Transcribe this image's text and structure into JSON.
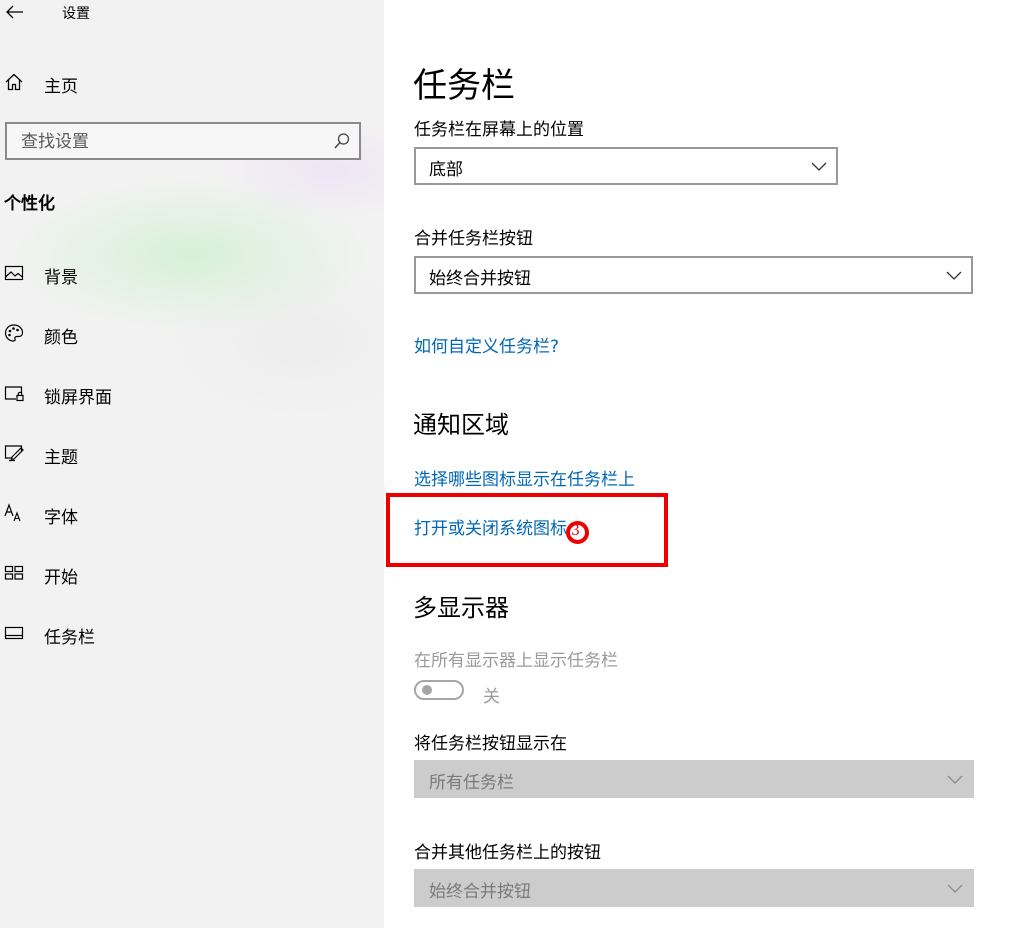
{
  "window": {
    "title": "设置"
  },
  "sidebar": {
    "home_label": "主页",
    "search_placeholder": "查找设置",
    "section_heading": "个性化",
    "items": [
      {
        "label": "背景",
        "icon": "picture-icon"
      },
      {
        "label": "颜色",
        "icon": "palette-icon"
      },
      {
        "label": "锁屏界面",
        "icon": "lock-screen-icon"
      },
      {
        "label": "主题",
        "icon": "theme-icon"
      },
      {
        "label": "字体",
        "icon": "font-icon"
      },
      {
        "label": "开始",
        "icon": "start-icon"
      },
      {
        "label": "任务栏",
        "icon": "taskbar-icon"
      }
    ]
  },
  "main": {
    "title": "任务栏",
    "position_label": "任务栏在屏幕上的位置",
    "position_value": "底部",
    "combine_label": "合并任务栏按钮",
    "combine_value": "始终合并按钮",
    "customize_link": "如何自定义任务栏?",
    "notification_heading": "通知区域",
    "select_icons_link": "选择哪些图标显示在任务栏上",
    "system_icons_link": "打开或关闭系统图标",
    "multi_display_heading": "多显示器",
    "show_all_label": "在所有显示器上显示任务栏",
    "toggle_state": "关",
    "show_buttons_label": "将任务栏按钮显示在",
    "show_buttons_value": "所有任务栏",
    "combine_other_label": "合并其他任务栏上的按钮",
    "combine_other_value": "始终合并按钮"
  },
  "annotation": {
    "marker": "3",
    "color": "#ee0000"
  },
  "colors": {
    "link": "#0067b8",
    "sidebar_bg": "#f2f2f2",
    "disabled": "#cccccc"
  }
}
